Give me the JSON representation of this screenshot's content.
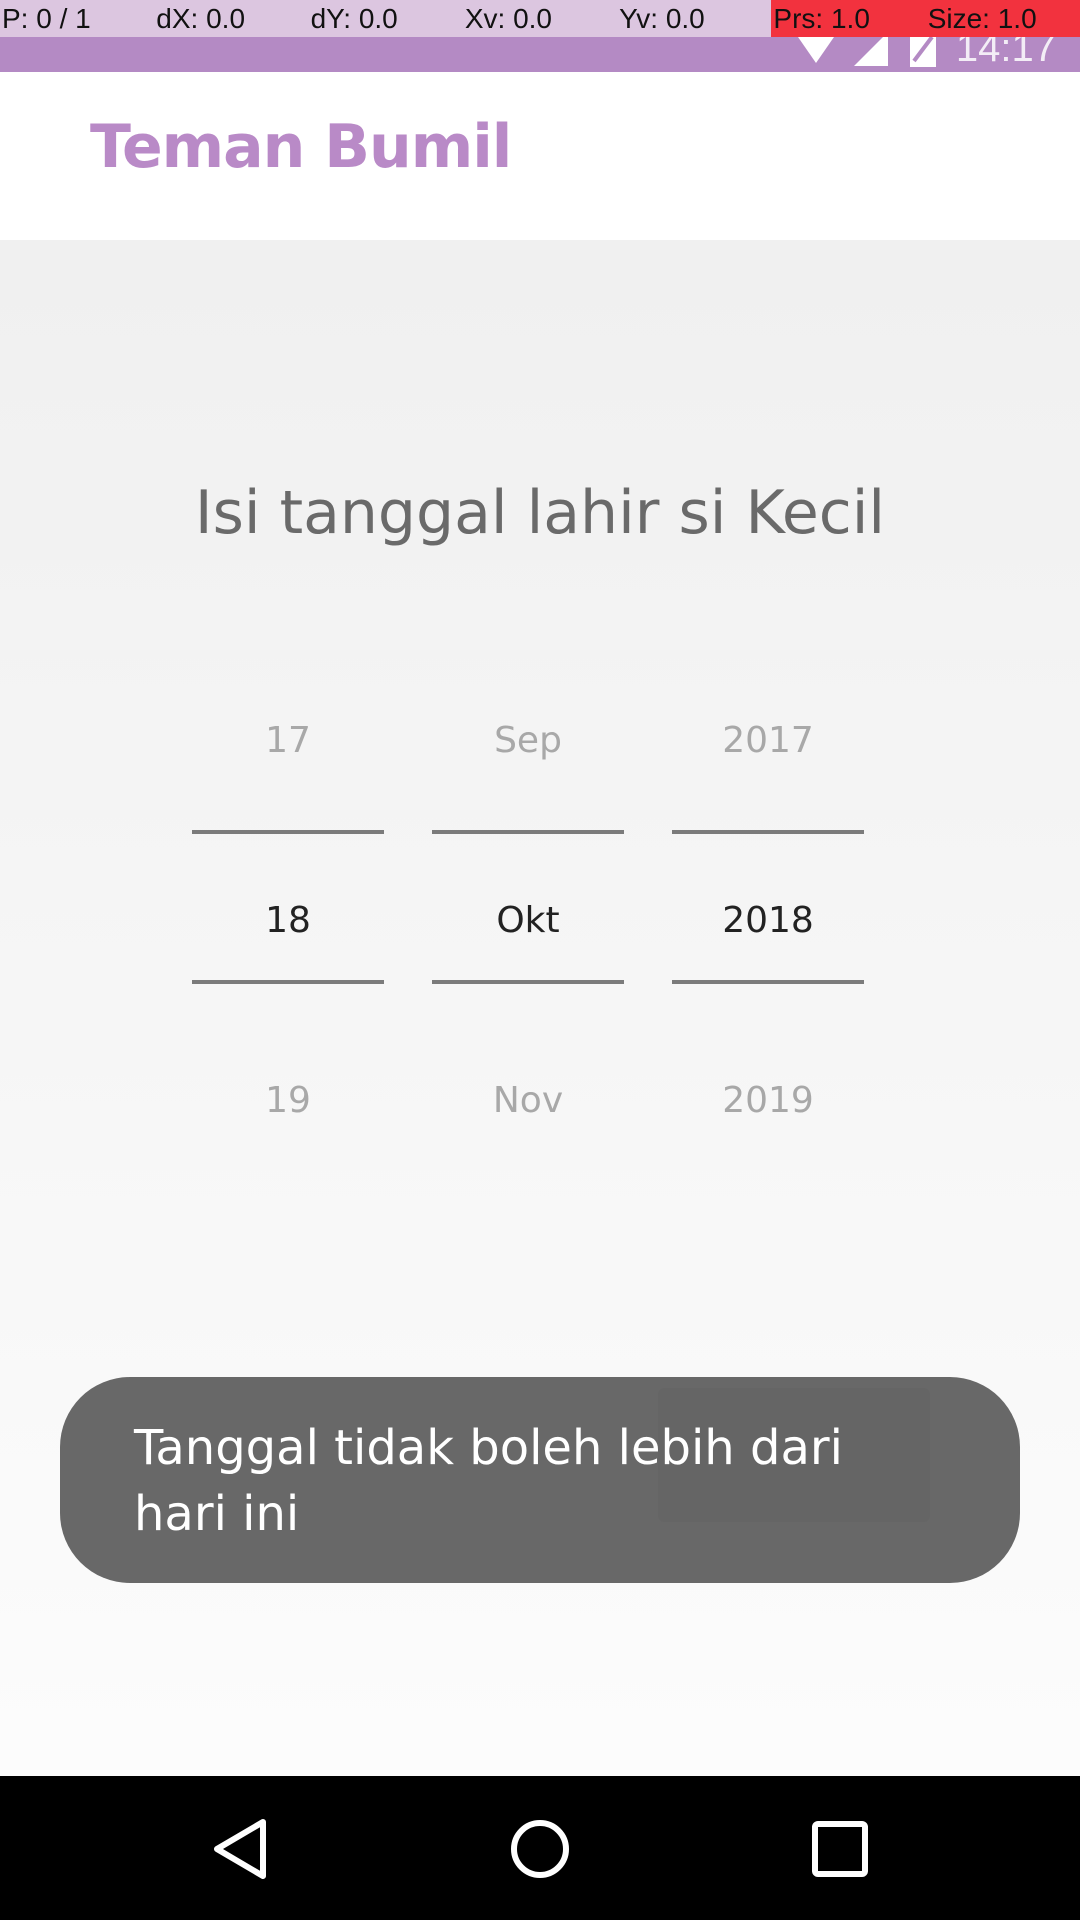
{
  "debug_overlay": {
    "pointer": "P: 0 / 1",
    "dx": "dX: 0.0",
    "dy": "dY: 0.0",
    "xv": "Xv: 0.0",
    "yv": "Yv: 0.0",
    "prs": "Prs: 1.0",
    "size": "Size: 1.0"
  },
  "status_bar": {
    "time": "14:17",
    "icons": [
      "wifi-icon",
      "signal-icon",
      "battery-icon"
    ]
  },
  "app_bar": {
    "title": "Teman Bumil"
  },
  "main": {
    "heading": "Isi tanggal lahir si Kecil",
    "day_picker": {
      "prev": "17",
      "current": "18",
      "next": "19"
    },
    "month_picker": {
      "prev": "Sep",
      "current": "Okt",
      "next": "Nov"
    },
    "year_picker": {
      "prev": "2017",
      "current": "2018",
      "next": "2019"
    }
  },
  "toast": {
    "message": "Tanggal tidak boleh lebih dari hari ini"
  },
  "nav_bar": {
    "icons": [
      "back-icon",
      "home-icon",
      "recents-icon"
    ]
  },
  "colors": {
    "status_bar": "#b48ac4",
    "brand": "#b98ac7",
    "toast_bg": "#5c5c5c",
    "nav_bar": "#000000"
  }
}
